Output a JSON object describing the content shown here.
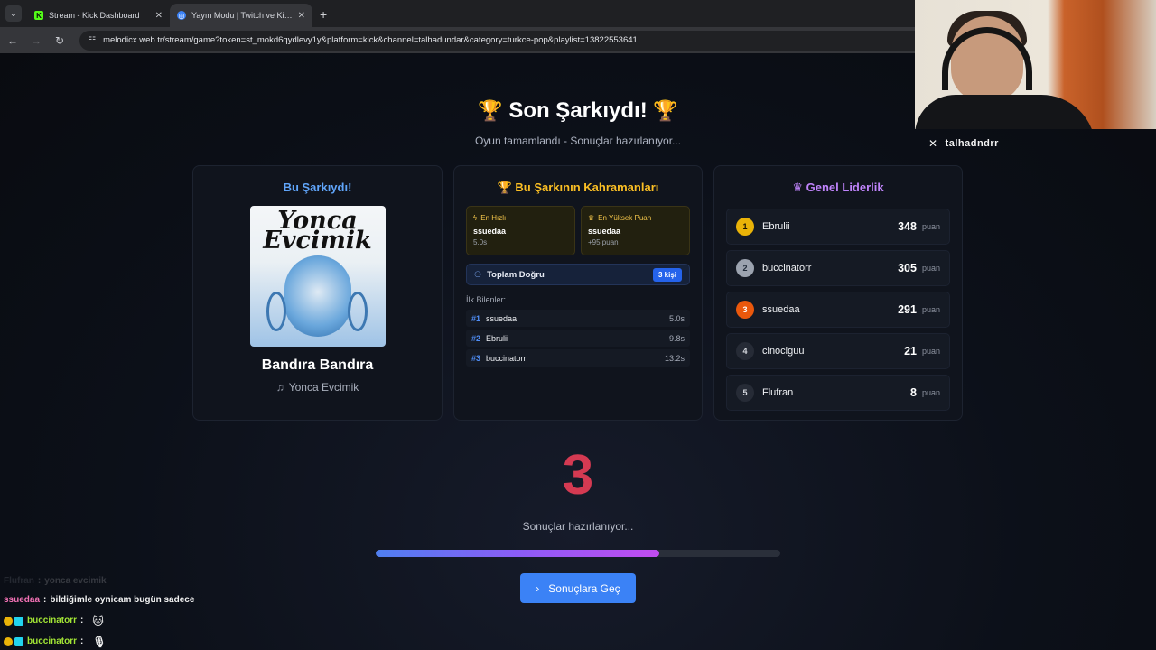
{
  "browser": {
    "tabs": [
      {
        "title": "Stream - Kick Dashboard",
        "active": false
      },
      {
        "title": "Yayın Modu | Twitch ve Kick ile",
        "active": true
      }
    ],
    "url": "melodicx.web.tr/stream/game?token=st_mokd6qydlevy1y&platform=kick&channel=talhadundar&category=turkce-pop&playlist=13822553641"
  },
  "social": {
    "handle": "talhadndrr"
  },
  "header": {
    "title": "Son Şarkıydı!",
    "trophy": "🏆",
    "subtitle": "Oyun tamamlandı - Sonuçlar hazırlanıyor..."
  },
  "song_card": {
    "title": "Bu Şarkıydı!",
    "cover_text_1": "Yonca",
    "cover_text_2": "Evcimik",
    "song": "Bandıra Bandıra",
    "artist": "Yonca Evcimik"
  },
  "heroes_card": {
    "title": "Bu Şarkının Kahramanları",
    "fastest": {
      "label": "En Hızlı",
      "user": "ssuedaa",
      "value": "5.0s"
    },
    "highest": {
      "label": "En Yüksek Puan",
      "user": "ssuedaa",
      "value": "+95 puan"
    },
    "total_label": "Toplam Doğru",
    "total_badge": "3 kişi",
    "first_label": "İlk Bilenler:",
    "first": [
      {
        "rank": "#1",
        "user": "ssuedaa",
        "time": "5.0s"
      },
      {
        "rank": "#2",
        "user": "Ebrulii",
        "time": "9.8s"
      },
      {
        "rank": "#3",
        "user": "buccinatorr",
        "time": "13.2s"
      }
    ]
  },
  "leader_card": {
    "title": "Genel Liderlik",
    "unit": "puan",
    "rows": [
      {
        "rank": "1",
        "user": "Ebrulii",
        "score": "348",
        "color": "#eab308"
      },
      {
        "rank": "2",
        "user": "buccinatorr",
        "score": "305",
        "color": "#9ca3af"
      },
      {
        "rank": "3",
        "user": "ssuedaa",
        "score": "291",
        "color": "#ea580c"
      },
      {
        "rank": "4",
        "user": "cinociguu",
        "score": "21",
        "color": "#262b36"
      },
      {
        "rank": "5",
        "user": "Flufran",
        "score": "8",
        "color": "#262b36"
      }
    ]
  },
  "countdown": {
    "value": "3",
    "label": "Sonuçlar hazırlanıyor...",
    "progress": 0.7
  },
  "next_button": {
    "label": "Sonuçlara Geç"
  },
  "chat": [
    {
      "user": "Flufran",
      "text": "yonca evcimik",
      "color": "#9aa0aa",
      "faded": true
    },
    {
      "user": "ssuedaa",
      "text": "bildiğimle oynicam bugün sadece",
      "color": "#f472b6",
      "faded": false
    },
    {
      "user": "buccinatorr",
      "text": "",
      "emote": "🐱",
      "color": "#a3e635",
      "faded": false
    },
    {
      "user": "buccinatorr",
      "text": "",
      "emote": "🎙",
      "color": "#a3e635",
      "faded": false
    }
  ],
  "colors": {
    "accent": "#3b82f6",
    "countdown": "#d53a52",
    "leader_title": "#c084fc",
    "song_title": "#60a5fa",
    "heroes_title": "#fbbf24"
  }
}
